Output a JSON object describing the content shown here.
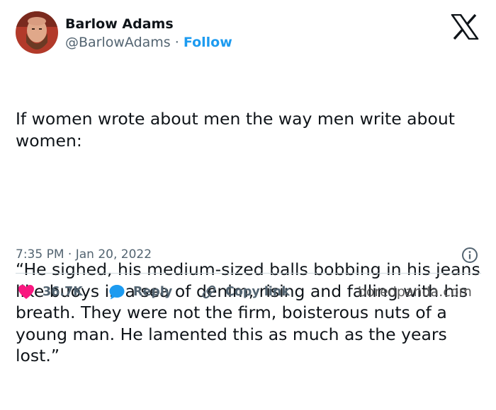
{
  "author": {
    "name": "Barlow Adams",
    "handle": "@BarlowAdams",
    "separator": "·",
    "follow_label": "Follow"
  },
  "tweet": {
    "paragraphs": [
      "If women wrote about men the way men write about women:",
      "“He sighed, his medium-sized balls bobbing in his jeans like buoys in a sea of denim, rising and falling with his breath. They were not the firm, boisterous nuts of a young man. He lamented this as much as the years lost.”"
    ],
    "timestamp": "7:35 PM · Jan 20, 2022"
  },
  "actions": {
    "like_count": "36.7K",
    "reply_label": "Reply",
    "copy_link_label": "Copy link"
  },
  "icons": {
    "brand": "x-logo-icon",
    "info": "info-icon",
    "like": "heart-icon",
    "reply": "speech-bubble-icon",
    "copy_link": "link-icon"
  },
  "colors": {
    "like": "#f91880",
    "reply": "#1d9bf0",
    "follow": "#1d9bf0",
    "secondary_text": "#536471"
  },
  "watermark": "boredpanda.com"
}
